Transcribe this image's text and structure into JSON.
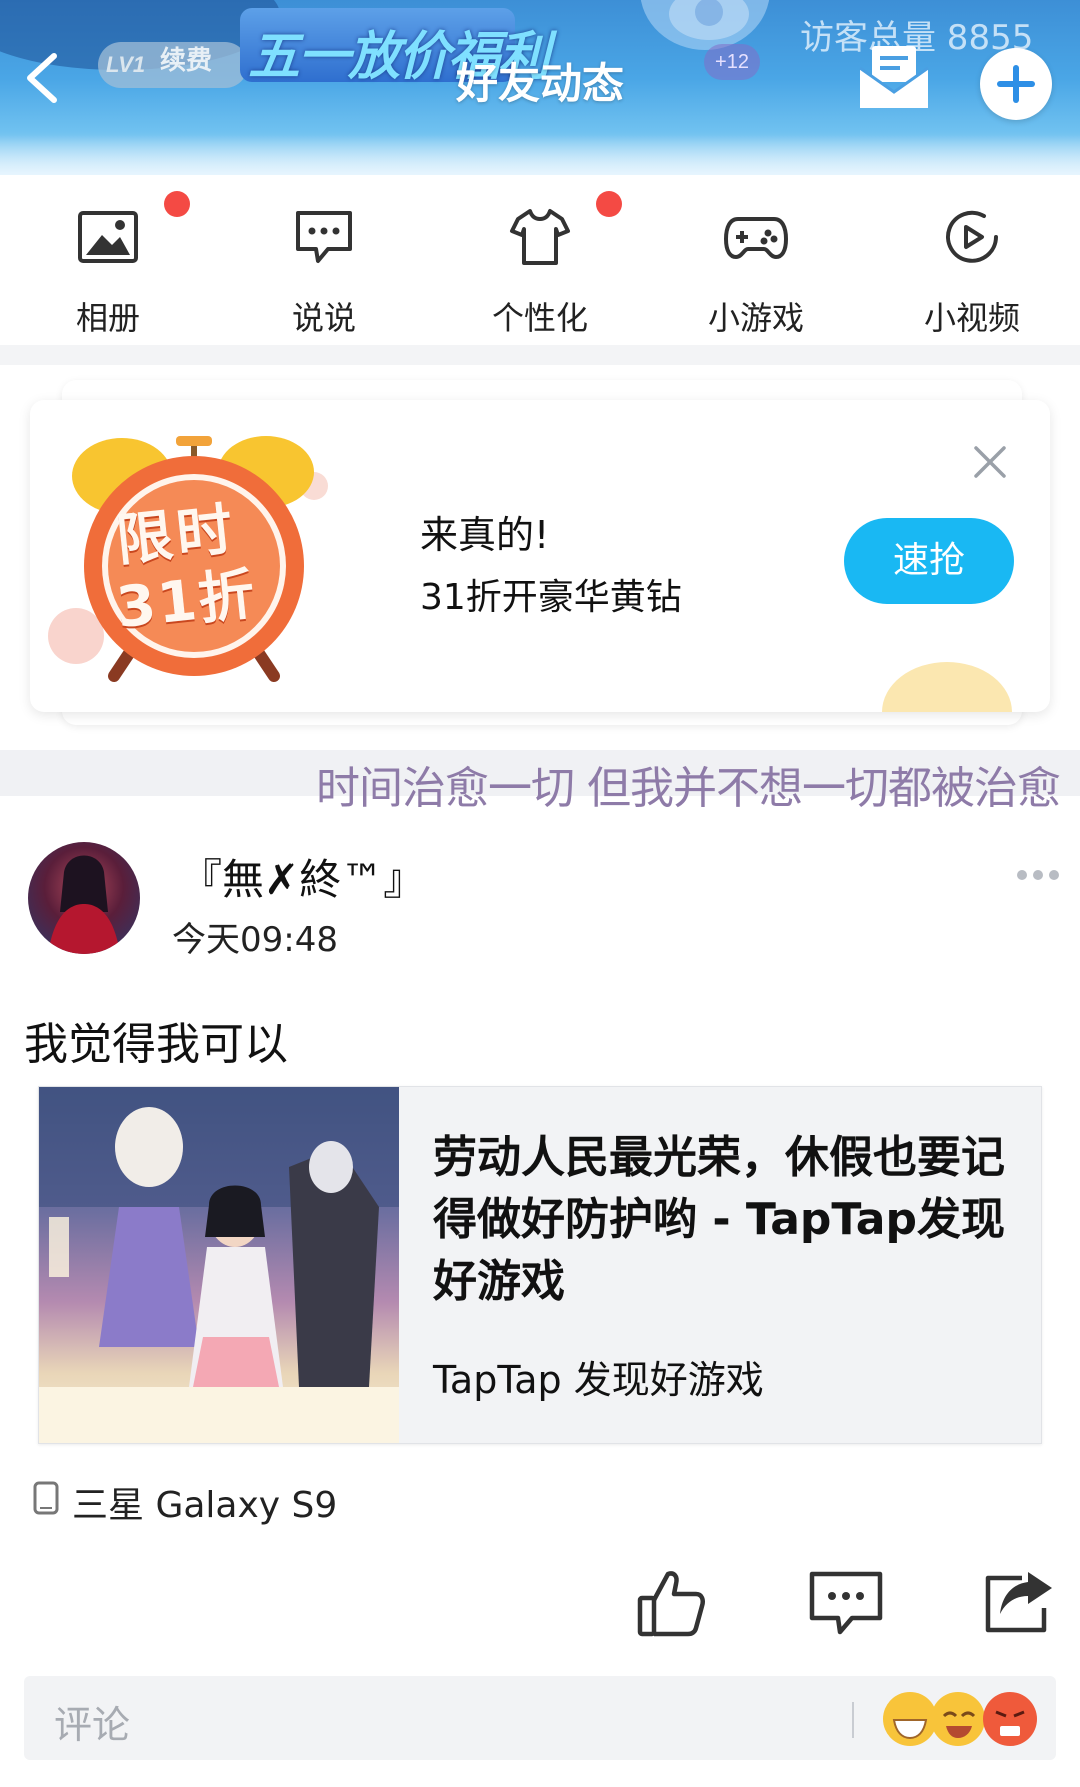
{
  "header": {
    "title": "好友动态",
    "vip_level": "LV1",
    "vip_renew": "续费",
    "promo_banner": "五一放价福利",
    "visitor_total": "访客总量 8855",
    "notification_count": "+12"
  },
  "shortcuts": [
    {
      "label": "相册",
      "badge": true
    },
    {
      "label": "说说",
      "badge": false
    },
    {
      "label": "个性化",
      "badge": true
    },
    {
      "label": "小游戏",
      "badge": false
    },
    {
      "label": "小视频",
      "badge": false
    }
  ],
  "ad": {
    "illustration_text_line1": "限时",
    "illustration_text_line2": "31折",
    "headline": "来真的!",
    "subline": "31折开豪华黄钻",
    "cta": "速抢"
  },
  "signature": "时间治愈一切 但我并不想一切都被治愈",
  "post": {
    "username": "『無✗終™』",
    "time": "今天09:48",
    "text": "我觉得我可以",
    "link": {
      "title": "劳动人民最光荣，休假也要记得做好防护哟 - TapTap发现好游戏",
      "source": "TapTap 发现好游戏"
    },
    "device": "三星 Galaxy S9"
  },
  "comment": {
    "placeholder": "评论"
  },
  "colors": {
    "accent_blue": "#19b8f3",
    "badge_red": "#f44a44",
    "signature_purple": "#8e7ba8"
  }
}
